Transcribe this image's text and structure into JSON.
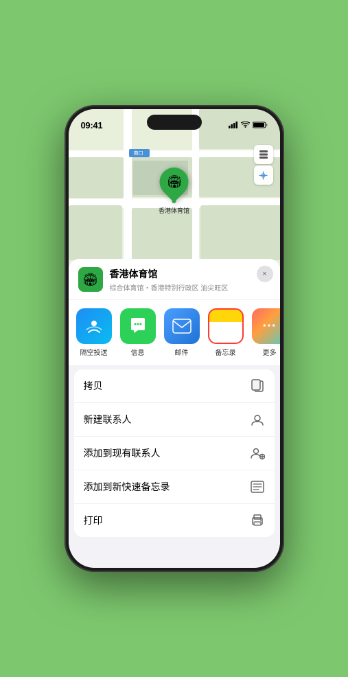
{
  "statusBar": {
    "time": "09:41",
    "location_icon": "▶"
  },
  "map": {
    "label_nankou": "南口",
    "map_icon_layers": "🗺",
    "map_icon_location": "➤"
  },
  "venue": {
    "name": "香港体育馆",
    "subtitle": "综合体育馆・香港特别行政区 油尖旺区",
    "icon_emoji": "🏟",
    "close_label": "×"
  },
  "shareApps": [
    {
      "id": "airdrop",
      "label": "隔空投送",
      "emoji": "📡"
    },
    {
      "id": "message",
      "label": "信息",
      "emoji": "💬"
    },
    {
      "id": "mail",
      "label": "邮件",
      "emoji": "✉"
    },
    {
      "id": "notes",
      "label": "备忘录",
      "emoji": ""
    },
    {
      "id": "more",
      "label": "更多",
      "emoji": "⋯"
    }
  ],
  "actions": [
    {
      "id": "copy",
      "label": "拷贝",
      "icon": "copy"
    },
    {
      "id": "new-contact",
      "label": "新建联系人",
      "icon": "person"
    },
    {
      "id": "add-existing",
      "label": "添加到现有联系人",
      "icon": "person-add"
    },
    {
      "id": "add-notes",
      "label": "添加到新快速备忘录",
      "icon": "notes"
    },
    {
      "id": "print",
      "label": "打印",
      "icon": "print"
    }
  ]
}
